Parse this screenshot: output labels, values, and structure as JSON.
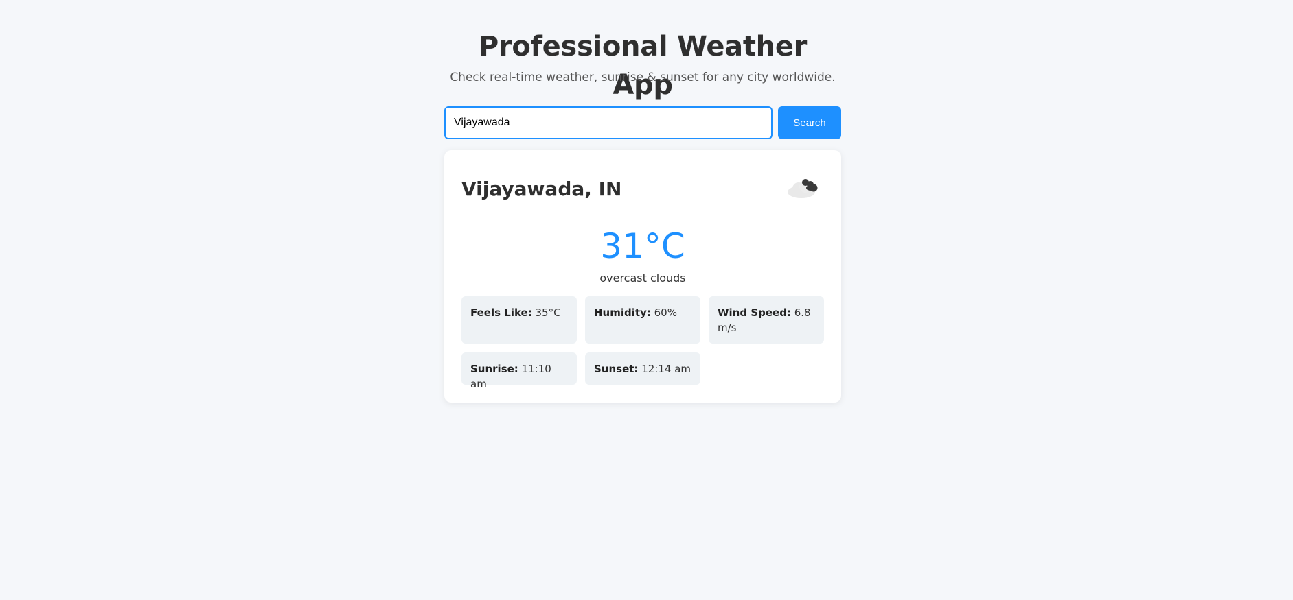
{
  "header": {
    "title": "Professional Weather App",
    "subtitle": "Check real-time weather, sunrise & sunset for any city worldwide."
  },
  "search": {
    "value": "Vijayawada",
    "button_label": "Search"
  },
  "weather": {
    "location": "Vijayawada, IN",
    "icon": "cloud-icon",
    "temperature": "31°C",
    "description": "overcast clouds",
    "details": [
      {
        "label": "Feels Like:",
        "value": "35°C"
      },
      {
        "label": "Humidity:",
        "value": "60%"
      },
      {
        "label": "Wind Speed:",
        "value": "6.8 m/s"
      },
      {
        "label": "Sunrise:",
        "value": "11:10 am"
      },
      {
        "label": "Sunset:",
        "value": "12:14 am"
      }
    ]
  },
  "colors": {
    "accent": "#1e90ff",
    "background": "#f5f7fa",
    "tile": "#eef2f5"
  }
}
